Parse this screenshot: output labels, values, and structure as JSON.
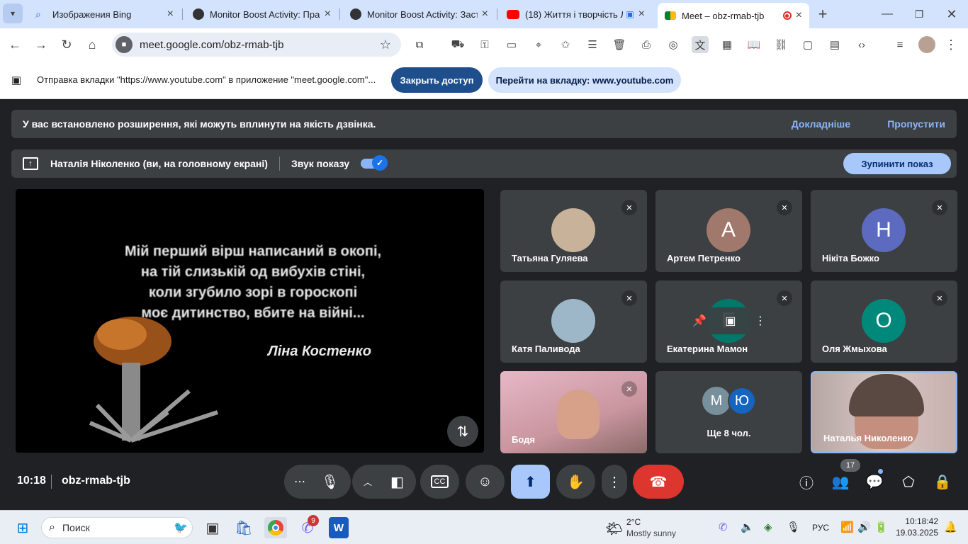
{
  "browser": {
    "tabs": [
      {
        "title": "Изображения Bing",
        "favicon": "search-icon",
        "color": "#1a73e8",
        "active": false
      },
      {
        "title": "Monitor Boost Activity: Прав",
        "favicon": "extension-icon",
        "color": "#333333",
        "active": false
      },
      {
        "title": "Monitor Boost Activity: Заст",
        "favicon": "extension-icon",
        "color": "#333333",
        "active": false
      },
      {
        "title": "(18) Життя і творчість Л",
        "favicon": "youtube-icon",
        "color": "#ff0000",
        "active": false
      },
      {
        "title": "Meet – obz-rmab-tjb",
        "favicon": "meet-icon",
        "color": "#00832d",
        "active": true
      }
    ],
    "new_tab": "+",
    "url": "meet.google.com/obz-rmab-tjb",
    "infobar": {
      "text": "Отправка вкладки \"https://www.youtube.com\" в приложение \"meet.google.com\"...",
      "stop_button": "Закрыть доступ",
      "goto_button": "Перейти на вкладку: www.youtube.com"
    }
  },
  "meet": {
    "extension_banner": {
      "text": "У вас встановлено розширення, які можуть вплинути на якість дзвінка.",
      "learn_more": "Докладніше",
      "skip": "Пропустити"
    },
    "presenting_bar": {
      "presenter": "Наталія Ніколенко (ви, на головному екрані)",
      "sound_label": "Звук показу",
      "sound_on": true,
      "stop_button": "Зупинити показ"
    },
    "shared_screen": {
      "poem_lines": [
        "Мій перший вірш написаний в окопі,",
        "на тій слизькій од вибухів стіні,",
        "коли згубило зорі в гороскопі",
        "моє дитинство, вбите на війні..."
      ],
      "author": "Ліна Костенко"
    },
    "participants": [
      {
        "name": "Татьяна Гуляева",
        "avatar": "",
        "avatar_color": "#c8b29a",
        "photo": true,
        "muted": true
      },
      {
        "name": "Артем Петренко",
        "avatar": "А",
        "avatar_color": "#a1786c",
        "photo": false,
        "muted": true
      },
      {
        "name": "Нікіта Божко",
        "avatar": "Н",
        "avatar_color": "#5c6bc0",
        "photo": false,
        "muted": true
      },
      {
        "name": "Катя Паливода",
        "avatar": "",
        "avatar_color": "#9db7c9",
        "photo": true,
        "muted": true
      },
      {
        "name": "Екатерина Мамон",
        "avatar": "Е",
        "avatar_color": "#00796b",
        "photo": false,
        "muted": true
      },
      {
        "name": "Оля Жмыхова",
        "avatar": "О",
        "avatar_color": "#00897b",
        "photo": false,
        "muted": true
      },
      {
        "name": "Бодя",
        "avatar": "",
        "avatar_color": "#d9a6b4",
        "photo": true,
        "muted": true
      },
      {
        "name": "Ще 8 чол.",
        "avatar": "",
        "avatar_color": "#3c4043",
        "photo": false,
        "muted": false
      },
      {
        "name": "Наталья Николенко",
        "avatar": "",
        "avatar_color": "#c9a9a4",
        "photo": true,
        "muted": false
      }
    ],
    "more_avatars": [
      "М",
      "Ю"
    ],
    "bottom": {
      "time": "10:18",
      "meeting_code": "obz-rmab-tjb",
      "people_count": "17"
    }
  },
  "taskbar": {
    "search_placeholder": "Поиск",
    "weather_temp": "2°C",
    "weather_desc": "Mostly sunny",
    "lang": "РУС",
    "time": "10:18:42",
    "date": "19.03.2025",
    "viber_badge": "9"
  }
}
